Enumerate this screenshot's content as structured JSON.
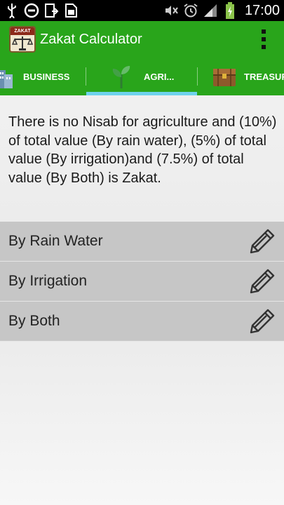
{
  "status_bar": {
    "time": "17:00",
    "icons": [
      "usb-icon",
      "blocked-icon",
      "download-icon",
      "sim-icon",
      "mute-icon",
      "alarm-icon",
      "signal-icon",
      "battery-icon"
    ]
  },
  "app_bar": {
    "title": "Zakat Calculator",
    "logo_text": "ZAKAT",
    "menu_icon": "overflow-menu-icon"
  },
  "tabs": [
    {
      "label": "BUSINESS",
      "icon": "buildings-icon",
      "selected": false
    },
    {
      "label": "AGRI...",
      "icon": "plant-icon",
      "selected": true
    },
    {
      "label": "TREASURE",
      "icon": "treasure-chest-icon",
      "selected": false
    }
  ],
  "description": "There is no Nisab for agriculture and (10%) of total value (By rain water), (5%) of total value (By irrigation)and (7.5%) of total value (By Both) is Zakat.",
  "options": [
    {
      "label": "By Rain Water",
      "icon": "pencil-icon"
    },
    {
      "label": "By Irrigation",
      "icon": "pencil-icon"
    },
    {
      "label": "By Both",
      "icon": "pencil-icon"
    }
  ],
  "colors": {
    "primary": "#29a51b",
    "tab_indicator": "#6fd3ec",
    "list_item_bg": "#c6c6c6"
  }
}
